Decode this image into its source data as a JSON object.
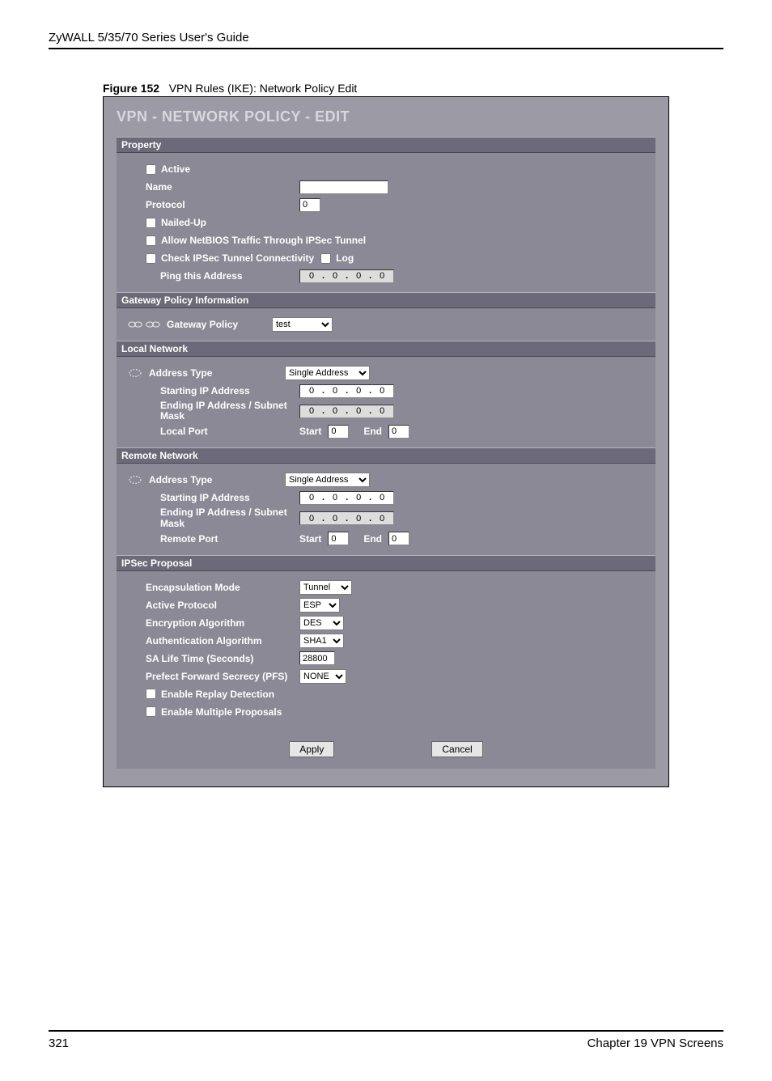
{
  "header": {
    "title": "ZyWALL 5/35/70 Series User's Guide"
  },
  "figure": {
    "number": "Figure 152",
    "caption": "VPN Rules (IKE): Network Policy Edit"
  },
  "screen": {
    "title": "VPN - NETWORK POLICY - EDIT"
  },
  "property": {
    "header": "Property",
    "active_label": "Active",
    "name_label": "Name",
    "name_value": "",
    "protocol_label": "Protocol",
    "protocol_value": "0",
    "nailed_up_label": "Nailed-Up",
    "netbios_label": "Allow NetBIOS Traffic Through IPSec Tunnel",
    "check_conn_label": "Check IPSec Tunnel Connectivity",
    "log_label": "Log",
    "ping_label": "Ping this Address",
    "ping_ip": [
      "0",
      "0",
      "0",
      "0"
    ]
  },
  "gateway": {
    "header": "Gateway Policy Information",
    "label": "Gateway Policy",
    "value": "test"
  },
  "local": {
    "header": "Local Network",
    "address_type_label": "Address Type",
    "address_type_value": "Single Address",
    "start_ip_label": "Starting IP Address",
    "start_ip": [
      "0",
      "0",
      "0",
      "0"
    ],
    "end_ip_label": "Ending IP Address / Subnet Mask",
    "end_ip": [
      "0",
      "0",
      "0",
      "0"
    ],
    "port_label": "Local Port",
    "port_start_label": "Start",
    "port_start": "0",
    "port_end_label": "End",
    "port_end": "0"
  },
  "remote": {
    "header": "Remote Network",
    "address_type_label": "Address Type",
    "address_type_value": "Single Address",
    "start_ip_label": "Starting IP Address",
    "start_ip": [
      "0",
      "0",
      "0",
      "0"
    ],
    "end_ip_label": "Ending IP Address / Subnet Mask",
    "end_ip": [
      "0",
      "0",
      "0",
      "0"
    ],
    "port_label": "Remote Port",
    "port_start_label": "Start",
    "port_start": "0",
    "port_end_label": "End",
    "port_end": "0"
  },
  "ipsec": {
    "header": "IPSec Proposal",
    "encap_label": "Encapsulation Mode",
    "encap_value": "Tunnel",
    "protocol_label": "Active Protocol",
    "protocol_value": "ESP",
    "encryption_label": "Encryption Algorithm",
    "encryption_value": "DES",
    "auth_label": "Authentication Algorithm",
    "auth_value": "SHA1",
    "sa_life_label": "SA Life Time (Seconds)",
    "sa_life_value": "28800",
    "pfs_label": "Prefect Forward Secrecy (PFS)",
    "pfs_value": "NONE",
    "replay_label": "Enable Replay Detection",
    "multi_label": "Enable Multiple Proposals"
  },
  "buttons": {
    "apply": "Apply",
    "cancel": "Cancel"
  },
  "footer": {
    "page": "321",
    "chapter": "Chapter 19 VPN Screens"
  }
}
